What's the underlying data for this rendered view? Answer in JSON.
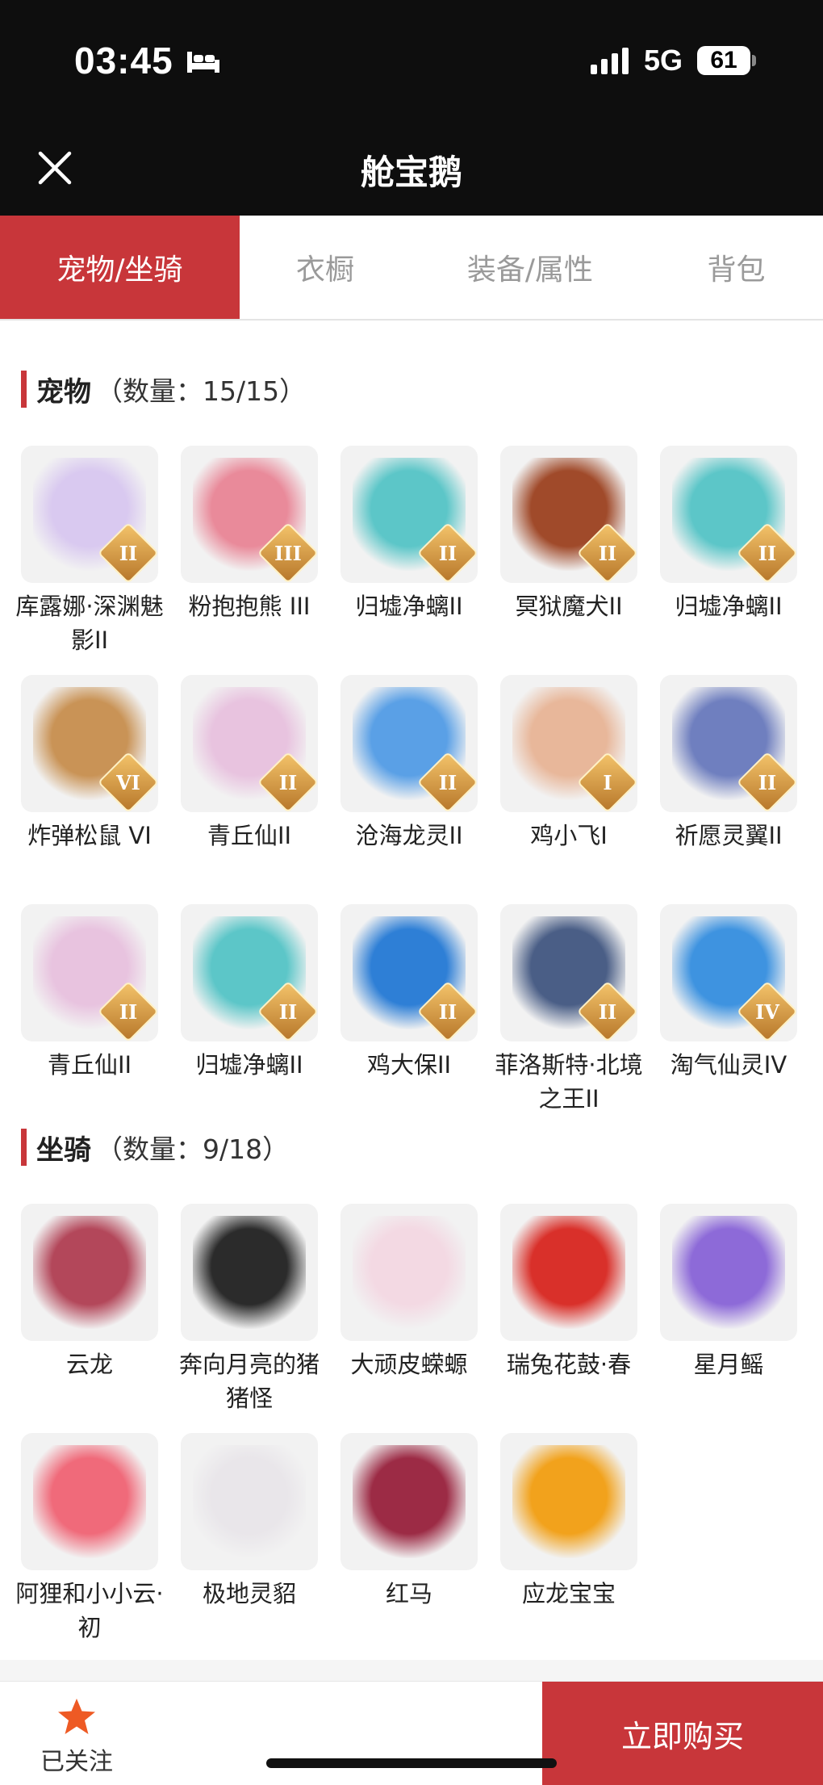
{
  "status_bar": {
    "time": "03:45",
    "network": "5G",
    "battery": "61"
  },
  "header": {
    "title": "舱宝鹅"
  },
  "tabs": [
    {
      "label": "宠物/坐骑",
      "active": true
    },
    {
      "label": "衣橱",
      "active": false
    },
    {
      "label": "装备/属性",
      "active": false
    },
    {
      "label": "背包",
      "active": false
    }
  ],
  "pets": {
    "title": "宠物",
    "count": "（数量：15/15）",
    "items": [
      {
        "name": "库露娜·深渊魅影II",
        "tier": "II",
        "color": "#d9c9f0"
      },
      {
        "name": "粉抱抱熊 III",
        "tier": "III",
        "color": "#e98a9a"
      },
      {
        "name": "归墟净螭II",
        "tier": "II",
        "color": "#5cc6c8"
      },
      {
        "name": "冥狱魔犬II",
        "tier": "II",
        "color": "#a04a2a"
      },
      {
        "name": "归墟净螭II",
        "tier": "II",
        "color": "#5cc6c8"
      },
      {
        "name": "炸弹松鼠 VI",
        "tier": "VI",
        "color": "#c99356"
      },
      {
        "name": "青丘仙II",
        "tier": "II",
        "color": "#e8c3df"
      },
      {
        "name": "沧海龙灵II",
        "tier": "II",
        "color": "#5aa0e6"
      },
      {
        "name": "鸡小飞I",
        "tier": "I",
        "color": "#e8b79a"
      },
      {
        "name": "祈愿灵翼II",
        "tier": "II",
        "color": "#6f7fbf"
      },
      {
        "name": "青丘仙II",
        "tier": "II",
        "color": "#e8c3df"
      },
      {
        "name": "归墟净螭II",
        "tier": "II",
        "color": "#5cc6c8"
      },
      {
        "name": "鸡大保II",
        "tier": "II",
        "color": "#2e7fd6"
      },
      {
        "name": "菲洛斯特·北境之王II",
        "tier": "II",
        "color": "#4a5e86"
      },
      {
        "name": "淘气仙灵IV",
        "tier": "IV",
        "color": "#3e93e0"
      }
    ]
  },
  "mounts": {
    "title": "坐骑",
    "count": "（数量：9/18）",
    "items": [
      {
        "name": "云龙",
        "color": "#b3475a"
      },
      {
        "name": "奔向月亮的猪猪怪",
        "color": "#2b2b2b"
      },
      {
        "name": "大顽皮蝾螈",
        "color": "#f3d9e3"
      },
      {
        "name": "瑞兔花鼓·春",
        "color": "#d9302a"
      },
      {
        "name": "星月鳐",
        "color": "#8d6ad8"
      },
      {
        "name": "阿狸和小小云·初",
        "color": "#f06a7a"
      },
      {
        "name": "极地灵貂",
        "color": "#e9e6ea"
      },
      {
        "name": "红马",
        "color": "#9c2b45"
      },
      {
        "name": "应龙宝宝",
        "color": "#f2a21c"
      }
    ]
  },
  "bottom": {
    "follow_label": "已关注",
    "buy_label": "立即购买"
  }
}
